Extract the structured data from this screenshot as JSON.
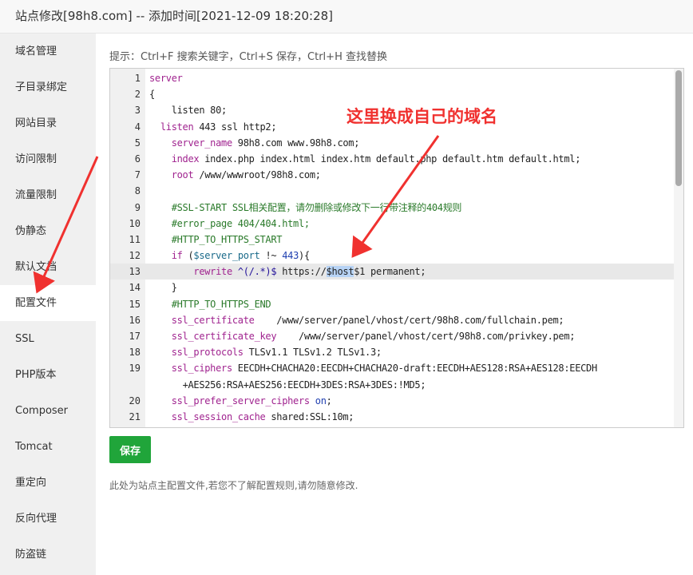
{
  "window": {
    "title": "站点修改[98h8.com] -- 添加时间[2021-12-09 18:20:28]"
  },
  "sidebar": {
    "active": "配置文件",
    "items": [
      "域名管理",
      "子目录绑定",
      "网站目录",
      "访问限制",
      "流量限制",
      "伪静态",
      "默认文档",
      "配置文件",
      "SSL",
      "PHP版本",
      "Composer",
      "Tomcat",
      "重定向",
      "反向代理",
      "防盗链"
    ]
  },
  "main": {
    "tip": "提示：Ctrl+F 搜索关键字，Ctrl+S 保存，Ctrl+H 查找替换",
    "save_label": "保存",
    "note": "此处为站点主配置文件,若您不了解配置规则,请勿随意修改.",
    "annotation": "这里换成自己的域名",
    "current_line": 13,
    "code": [
      [
        [
          "kw",
          "server"
        ]
      ],
      [
        [
          "",
          "{"
        ]
      ],
      [
        [
          "",
          "    listen 80;"
        ]
      ],
      [
        [
          "kw",
          "  listen"
        ],
        [
          "",
          " 443 ssl http2;"
        ]
      ],
      [
        [
          "kw",
          "    server_name"
        ],
        [
          "",
          " 98h8.com www.98h8.com;"
        ]
      ],
      [
        [
          "kw",
          "    index"
        ],
        [
          "",
          " index.php index.html index.htm default.php default.htm default.html;"
        ]
      ],
      [
        [
          "kw",
          "    root"
        ],
        [
          "",
          " /www/wwwroot/98h8.com;"
        ]
      ],
      [
        [
          "",
          "    "
        ]
      ],
      [
        [
          "cm",
          "    #SSL-START SSL相关配置，请勿删除或修改下一行带注释的404规则"
        ]
      ],
      [
        [
          "cm",
          "    #error_page 404/404.html;"
        ]
      ],
      [
        [
          "cm",
          "    #HTTP_TO_HTTPS_START"
        ]
      ],
      [
        [
          "kw",
          "    if"
        ],
        [
          "",
          " ("
        ],
        [
          "vr",
          "$server_port"
        ],
        [
          "",
          " !~ "
        ],
        [
          "nm",
          "443"
        ],
        [
          "",
          "){"
        ]
      ],
      [
        [
          "kw",
          "        rewrite"
        ],
        [
          "",
          " "
        ],
        [
          "rx",
          "^(/.*)$"
        ],
        [
          "",
          " https://"
        ],
        [
          "sel",
          "$host"
        ],
        [
          "",
          "$1 permanent;"
        ]
      ],
      [
        [
          "",
          "    }"
        ]
      ],
      [
        [
          "cm",
          "    #HTTP_TO_HTTPS_END"
        ]
      ],
      [
        [
          "kw",
          "    ssl_certificate"
        ],
        [
          "",
          "    /www/server/panel/vhost/cert/98h8.com/fullchain.pem;"
        ]
      ],
      [
        [
          "kw",
          "    ssl_certificate_key"
        ],
        [
          "",
          "    /www/server/panel/vhost/cert/98h8.com/privkey.pem;"
        ]
      ],
      [
        [
          "kw",
          "    ssl_protocols"
        ],
        [
          "",
          " TLSv1.1 TLSv1.2 TLSv1.3;"
        ]
      ],
      [
        [
          "kw",
          "    ssl_ciphers"
        ],
        [
          "",
          " EECDH+CHACHA20:EECDH+CHACHA20-draft:EECDH+AES128:RSA+AES128:EECDH\n      +AES256:RSA+AES256:EECDH+3DES:RSA+3DES:!MD5;"
        ]
      ],
      [
        [
          "kw",
          "    ssl_prefer_server_ciphers"
        ],
        [
          "",
          " "
        ],
        [
          "nm",
          "on"
        ],
        [
          "",
          ";"
        ]
      ],
      [
        [
          "kw",
          "    ssl_session_cache"
        ],
        [
          "",
          " shared:SSL:10m;"
        ]
      ]
    ]
  },
  "colors": {
    "accent": "#20a53a",
    "annotation": "#f0312f"
  }
}
